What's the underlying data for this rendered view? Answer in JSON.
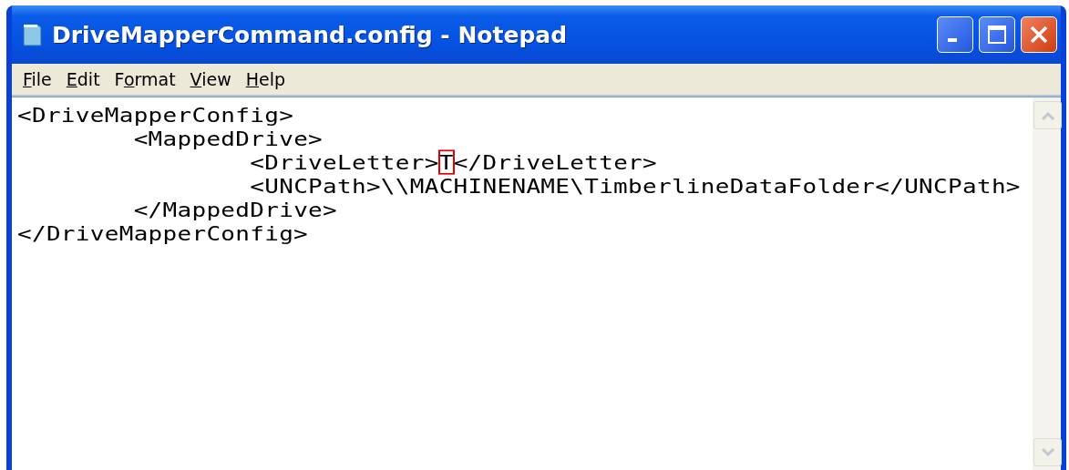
{
  "window": {
    "title": "DriveMapperCommand.config - Notepad"
  },
  "menu": [
    {
      "key": "F",
      "after": "ile"
    },
    {
      "key": "E",
      "after": "dit"
    },
    {
      "before": "F",
      "key": "o",
      "after": "rmat"
    },
    {
      "key": "V",
      "after": "iew"
    },
    {
      "key": "H",
      "after": "elp"
    }
  ],
  "editor": {
    "lines": [
      {
        "parts": [
          {
            "text": "<DriveMapperConfig>",
            "marked": false
          }
        ]
      },
      {
        "parts": [
          {
            "text": "\t<MappedDrive>",
            "marked": false
          }
        ]
      },
      {
        "parts": [
          {
            "text": "\t\t<DriveLetter>",
            "marked": false
          },
          {
            "text": "T",
            "marked": true
          },
          {
            "text": "</DriveLetter>",
            "marked": false
          }
        ]
      },
      {
        "parts": [
          {
            "text": "\t\t<UNCPath>\\\\MACHINENAME\\TimberlineDataFolder</UNCPath>",
            "marked": false
          }
        ]
      },
      {
        "parts": [
          {
            "text": "\t</MappedDrive>",
            "marked": false
          }
        ]
      },
      {
        "parts": [
          {
            "text": "</DriveMapperConfig>",
            "marked": false
          }
        ]
      }
    ]
  }
}
